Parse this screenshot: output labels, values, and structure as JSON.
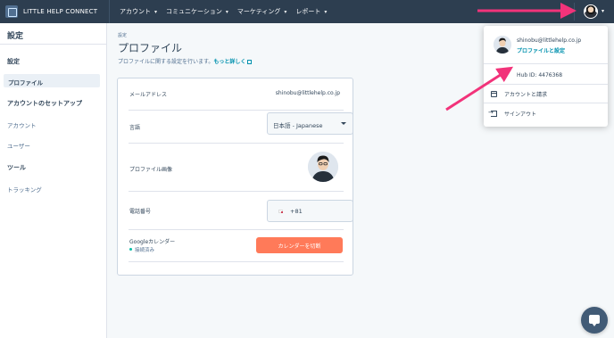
{
  "topnav": {
    "brand": "LITTLE HELP CONNECT",
    "items": [
      {
        "label": "アカウント"
      },
      {
        "label": "コミュニケーション"
      },
      {
        "label": "マーケティング"
      },
      {
        "label": "レポート"
      }
    ]
  },
  "sidebar": {
    "title": "設定",
    "sections": [
      {
        "heading": "設定",
        "items": [
          "プロファイル"
        ]
      },
      {
        "heading": "アカウントのセットアップ",
        "items": [
          "アカウント",
          "ユーザー"
        ]
      },
      {
        "heading": "ツール",
        "items": [
          "トラッキング"
        ]
      }
    ]
  },
  "main": {
    "breadcrumb": "設定",
    "title": "プロファイル",
    "description": "プロファイルに関する設定を行います。",
    "more_link": "もっと詳しく",
    "fields": {
      "email_label": "メールアドレス",
      "email_value": "shinobu@littlehelp.co.jp",
      "language_label": "言語",
      "language_value": "日本語 - Japanese",
      "photo_label": "プロファイル画像",
      "phone_label": "電話番号",
      "phone_code": "+81",
      "gcal_label": "Googleカレンダー",
      "gcal_status": "接続済み",
      "gcal_button": "カレンダーを切断"
    }
  },
  "dropdown": {
    "email": "shinobu@littlehelp.co.jp",
    "profile_link": "プロファイルと設定",
    "hub_id": "Hub ID: 4476368",
    "account_billing": "アカウントと請求",
    "sign_out": "サインアウト"
  },
  "colors": {
    "nav_bg": "#2d3e50",
    "accent_link": "#0091ae",
    "primary_button": "#ff7a59",
    "annotation_arrow": "#f2337a"
  }
}
